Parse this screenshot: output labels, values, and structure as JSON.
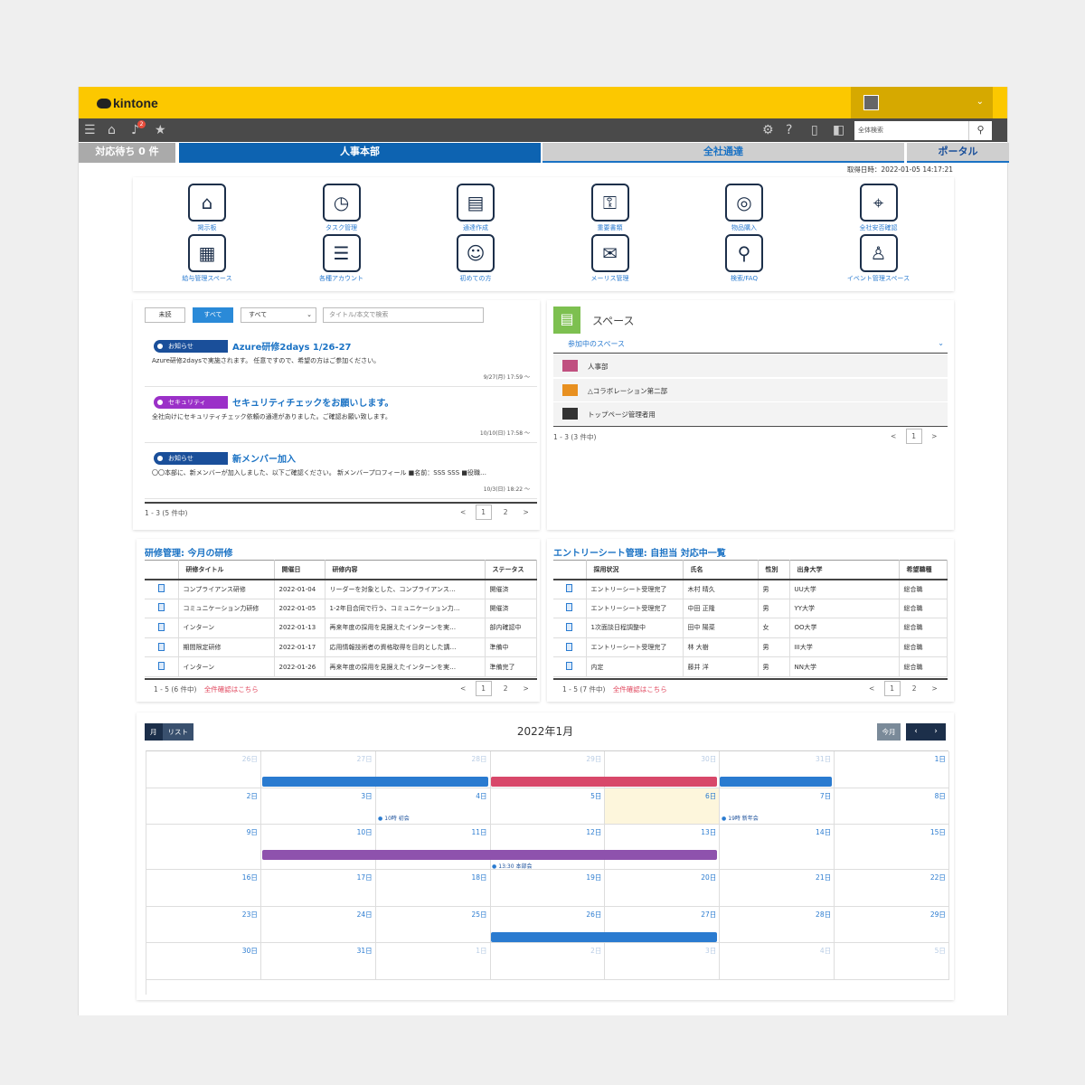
{
  "app": {
    "logo": "kintone"
  },
  "nav": {
    "notification_count": "2",
    "search_placeholder": "全体検索"
  },
  "tabs": [
    "対応待ち 0 件",
    "人事本部",
    "全社通達",
    "ポータル"
  ],
  "timestamp": "取得日時：2022-01-05 14:17:21",
  "apps": [
    {
      "label": "掲示板",
      "icon": "house-icon",
      "glyph": "⌂"
    },
    {
      "label": "タスク管理",
      "icon": "clock-icon",
      "glyph": "◷"
    },
    {
      "label": "通達作成",
      "icon": "podium-icon",
      "glyph": "▤"
    },
    {
      "label": "重要書類",
      "icon": "key-icon",
      "glyph": "⚿"
    },
    {
      "label": "物品購入",
      "icon": "coins-icon",
      "glyph": "◎"
    },
    {
      "label": "全社安否確認",
      "icon": "map-pin-icon",
      "glyph": "⌖"
    },
    {
      "label": "給与管理スペース",
      "icon": "invoice-icon",
      "glyph": "▦"
    },
    {
      "label": "各種アカウント",
      "icon": "list-icon",
      "glyph": "☰"
    },
    {
      "label": "初めての方",
      "icon": "face-icon",
      "glyph": "☺"
    },
    {
      "label": "メーリス管理",
      "icon": "mail-icon",
      "glyph": "✉"
    },
    {
      "label": "検索/FAQ",
      "icon": "magnifier-icon",
      "glyph": "⚲"
    },
    {
      "label": "イベント管理スペース",
      "icon": "glasses-icon",
      "glyph": "♙"
    }
  ],
  "notices": {
    "filters": {
      "unread": "未読",
      "all": "すべて",
      "select": "すべて",
      "search_placeholder": "タイトル/本文で検索"
    },
    "items": [
      {
        "tag": "お知らせ",
        "tag_color": "#1a4f9a",
        "title": "Azure研修2days 1/26-27",
        "body": "Azure研修2daysで実施されます。 任意ですので、希望の方はご参加ください。",
        "date": "9/27(月) 17:59 ～"
      },
      {
        "tag": "セキュリティ",
        "tag_color": "#9b30c8",
        "title": "セキュリティチェックをお願いします。",
        "body": "全社向けにセキュリティチェック依頼の通達がありました。ご確認お願い致します。",
        "date": "10/10(日) 17:58 ～"
      },
      {
        "tag": "お知らせ",
        "tag_color": "#1a4f9a",
        "title": "新メンバー加入",
        "body": "〇〇本部に、新メンバーが加入しました、以下ご確認ください。 新メンバープロフィール ■名前：SSS SSS ■役職…",
        "date": "10/3(日) 18:22 ～"
      }
    ],
    "count": "1 - 3 (5 件中)",
    "pages": [
      "1",
      "2"
    ]
  },
  "spaces": {
    "title": "スペース",
    "dropdown": "参加中のスペース",
    "items": [
      "人事部",
      "△コラボレーション第二部",
      "トップページ管理者用"
    ],
    "count": "1 - 3 (3 件中)",
    "page": "1"
  },
  "training": {
    "title": "研修管理: 今月の研修",
    "headers": [
      "研修タイトル",
      "開催日",
      "研修内容",
      "ステータス"
    ],
    "rows": [
      [
        "コンプライアンス研修",
        "2022-01-04",
        "リーダーを対象とした、コンプライアンス…",
        "開催済"
      ],
      [
        "コミュニケーション力研修",
        "2022-01-05",
        "1-2年目合同で行う、コミュニケーション力…",
        "開催済"
      ],
      [
        "インターン",
        "2022-01-13",
        "再来年度の採用を見据えたインターンを実…",
        "部内確認中"
      ],
      [
        "期間限定研修",
        "2022-01-17",
        "応用情報技術者の資格取得を目的とした講…",
        "準備中"
      ],
      [
        "インターン",
        "2022-01-26",
        "再来年度の採用を見据えたインターンを実…",
        "準備完了"
      ]
    ],
    "count": "1 - 5 (6 件中)",
    "all_link": "全件確認はこちら",
    "pages": [
      "1",
      "2"
    ]
  },
  "entries": {
    "title": "エントリーシート管理: 自担当 対応中一覧",
    "headers": [
      "採用状況",
      "氏名",
      "性別",
      "出身大学",
      "希望職種"
    ],
    "rows": [
      [
        "エントリーシート受理完了",
        "木村 晴久",
        "男",
        "UU大学",
        "総合職"
      ],
      [
        "エントリーシート受理完了",
        "中田 正隆",
        "男",
        "YY大学",
        "総合職"
      ],
      [
        "1次面談日程調整中",
        "田中 陽菜",
        "女",
        "OO大学",
        "総合職"
      ],
      [
        "エントリーシート受理完了",
        "林 大樹",
        "男",
        "III大学",
        "総合職"
      ],
      [
        "内定",
        "藤井 洋",
        "男",
        "NN大学",
        "総合職"
      ]
    ],
    "count": "1 - 5 (7 件中)",
    "all_link": "全件確認はこちら",
    "pages": [
      "1",
      "2"
    ]
  },
  "calendar": {
    "title": "2022年1月",
    "view_month": "月",
    "view_list": "リスト",
    "today": "今月",
    "days": [
      "26日",
      "27日",
      "28日",
      "29日",
      "30日",
      "31日",
      "1日",
      "2日",
      "3日",
      "4日",
      "5日",
      "6日",
      "7日",
      "8日",
      "9日",
      "10日",
      "11日",
      "12日",
      "13日",
      "14日",
      "15日",
      "16日",
      "17日",
      "18日",
      "19日",
      "20日",
      "21日",
      "22日",
      "23日",
      "24日",
      "25日",
      "26日",
      "27日",
      "28日",
      "29日",
      "30日",
      "31日",
      "1日",
      "2日",
      "3日",
      "4日",
      "5日"
    ],
    "events": [
      {
        "label": "10時 初会"
      },
      {
        "label": "19時 新年会"
      },
      {
        "label": "13:30 本部会"
      }
    ]
  }
}
